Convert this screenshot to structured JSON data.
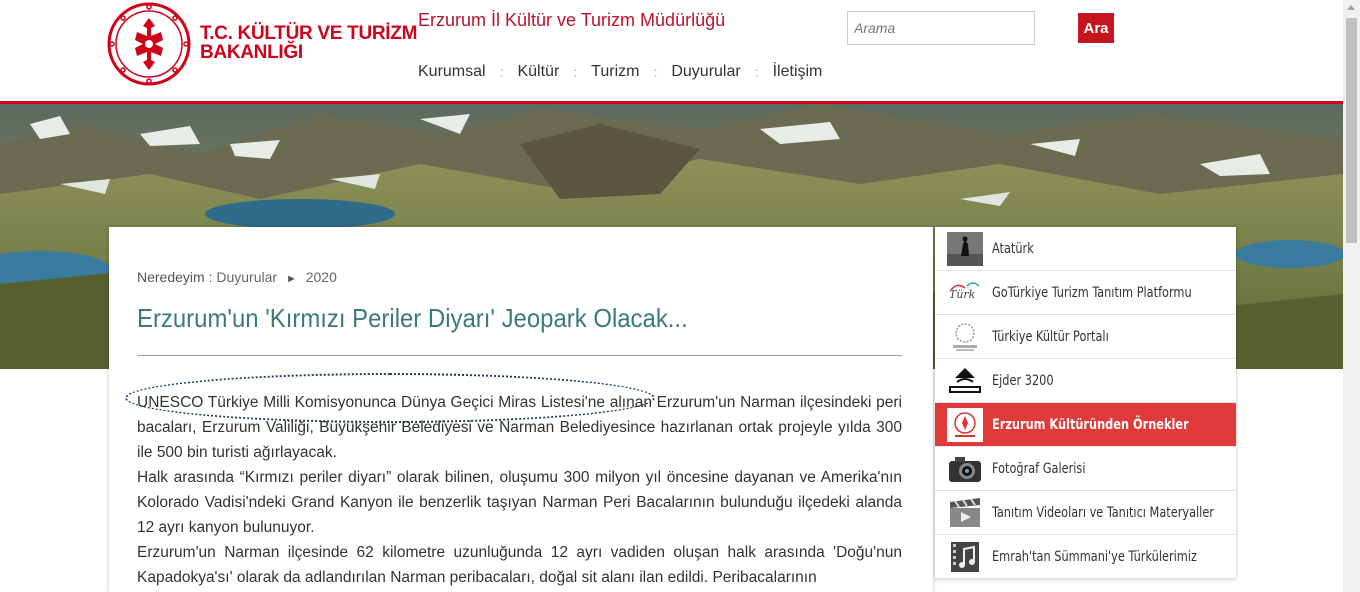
{
  "header": {
    "brand_line1": "T.C. KÜLTÜR VE TURİZM",
    "brand_line2": "BAKANLIĞI",
    "site_title": "Erzurum İl Kültür ve Turizm Müdürlüğü",
    "nav": [
      "Kurumsal",
      "Kültür",
      "Turizm",
      "Duyurular",
      "İletişim"
    ],
    "nav_separator": ":",
    "search_placeholder": "Arama",
    "search_button": "Ara",
    "brand_color": "#d0021b"
  },
  "breadcrumb": {
    "label": "Neredeyim :",
    "items": [
      "Duyurular",
      "2020"
    ],
    "separator": "►"
  },
  "article": {
    "title": "Erzurum'un 'Kırmızı Periler Diyarı' Jeopark Olacak...",
    "paragraphs": [
      "UNESCO Türkiye Milli Komisyonunca Dünya Geçici Miras Listesi'ne alınan Erzurum'un Narman ilçesindeki peri bacaları, Erzurum Valiliği, Büyükşehir Belediyesi ve Narman Belediyesince hazırlanan ortak projeyle yılda 300 ile 500 bin turisti ağırlayacak.",
      "Halk arasında “Kırmızı periler diyarı” olarak bilinen, oluşumu 300 milyon yıl öncesine dayanan ve Amerika'nın Kolorado Vadisi'ndeki Grand Kanyon ile benzerlik taşıyan Narman Peri Bacalarının bulunduğu ilçedeki alanda 12 ayrı kanyon bulunuyor.",
      "Erzurum'un Narman ilçesinde 62 kilometre uzunluğunda 12 ayrı vadiden oluşan halk arasında 'Doğu'nun Kapadokya'sı' olarak da adlandırılan Narman peribacaları, doğal sit alanı ilan edildi. Peribacalarının"
    ],
    "title_color": "#3a7a7a"
  },
  "sidebar": {
    "items": [
      {
        "label": "Atatürk",
        "icon": "ataturk-icon"
      },
      {
        "label": "GoTürkiye Turizm Tanıtım Platformu",
        "icon": "goturkiye-logo-icon"
      },
      {
        "label": "Türkiye Kültür Portalı",
        "icon": "kultur-portali-logo-icon"
      },
      {
        "label": "Ejder 3200",
        "icon": "ejder-3200-logo-icon"
      },
      {
        "label": "Erzurum Kültüründen Örnekler",
        "icon": "erzurum-kultur-logo-icon",
        "active": true
      },
      {
        "label": "Fotoğraf Galerisi",
        "icon": "camera-icon"
      },
      {
        "label": "Tanıtım Videoları ve Tanıtıcı Materyaller",
        "icon": "film-clapper-icon"
      },
      {
        "label": "Emrah'tan Sümmani'ye Türkülerimiz",
        "icon": "music-film-icon"
      }
    ],
    "active_color": "#e03a3a"
  }
}
